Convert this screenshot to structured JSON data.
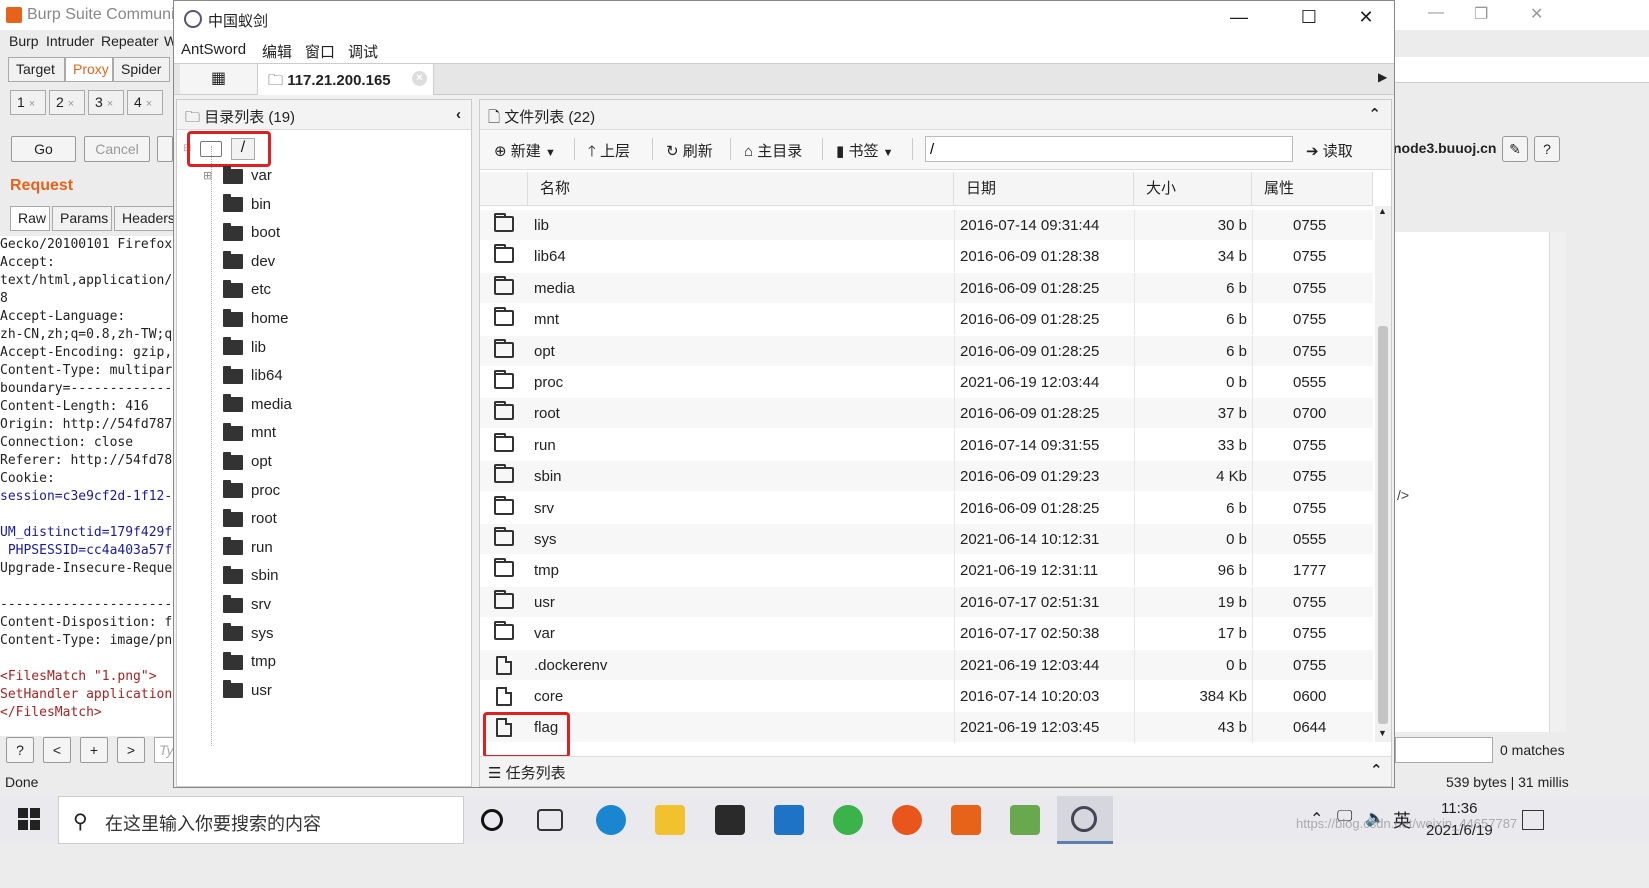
{
  "burp": {
    "title": "Burp Suite Communit",
    "menu": [
      "Burp",
      "Intruder",
      "Repeater",
      "W"
    ],
    "main_tabs": [
      "Target",
      "Proxy",
      "Spider"
    ],
    "sub_tabs": [
      "1",
      "2",
      "3",
      "4"
    ],
    "go_label": "Go",
    "cancel_label": "Cancel",
    "request_label": "Request",
    "req_tabs": [
      "Raw",
      "Params",
      "Headers"
    ],
    "request_lines": [
      {
        "t": "Gecko/20100101 Firefox/",
        "c": ""
      },
      {
        "t": "Accept:",
        "c": ""
      },
      {
        "t": "text/html,application/:",
        "c": ""
      },
      {
        "t": "8",
        "c": ""
      },
      {
        "t": "Accept-Language:",
        "c": ""
      },
      {
        "t": "zh-CN,zh;q=0.8,zh-TW;q",
        "c": ""
      },
      {
        "t": "Accept-Encoding: gzip,",
        "c": ""
      },
      {
        "t": "Content-Type: multipar",
        "c": ""
      },
      {
        "t": "boundary=--------------",
        "c": ""
      },
      {
        "t": "Content-Length: 416",
        "c": ""
      },
      {
        "t": "Origin: http://54fd787",
        "c": ""
      },
      {
        "t": "Connection: close",
        "c": ""
      },
      {
        "t": "Referer: http://54fd78",
        "c": ""
      },
      {
        "t": "Cookie:",
        "c": ""
      },
      {
        "t": "session=c3e9cf2d-1f12-",
        "c": "blue"
      },
      {
        "t": "",
        "c": ""
      },
      {
        "t": "UM_distinctid=179f429f",
        "c": "blue"
      },
      {
        "t": " PHPSESSID=cc4a403a57f",
        "c": "blue"
      },
      {
        "t": "Upgrade-Insecure-Reques",
        "c": ""
      },
      {
        "t": "",
        "c": ""
      },
      {
        "t": "-----------------------",
        "c": ""
      },
      {
        "t": "Content-Disposition: f",
        "c": ""
      },
      {
        "t": "Content-Type: image/pn",
        "c": ""
      },
      {
        "t": "",
        "c": ""
      },
      {
        "t": "<FilesMatch \"1.png\">",
        "c": "red"
      },
      {
        "t": "SetHandler application",
        "c": "red"
      },
      {
        "t": "</FilesMatch>",
        "c": "red"
      }
    ],
    "host": "node3.buuoj.cn",
    "right_tag": "/>",
    "matches": "0 matches",
    "status_left": "Done",
    "status_right": "539 bytes | 31 millis",
    "search_placeholder": "Ty"
  },
  "antsword": {
    "title": "中国蚁剑",
    "menu": [
      "AntSword",
      "编辑",
      "窗口",
      "调试"
    ],
    "tab_label": "117.21.200.165",
    "dir_panel_title": "目录列表 (19)",
    "tree_root": "/",
    "tree": [
      "var",
      "bin",
      "boot",
      "dev",
      "etc",
      "home",
      "lib",
      "lib64",
      "media",
      "mnt",
      "opt",
      "proc",
      "root",
      "run",
      "sbin",
      "srv",
      "sys",
      "tmp",
      "usr"
    ],
    "file_panel_title": "文件列表 (22)",
    "toolbar": {
      "new": "新建",
      "up": "上层",
      "refresh": "刷新",
      "home": "主目录",
      "bookmark": "书签",
      "path": "/",
      "read": "读取"
    },
    "columns": [
      "名称",
      "日期",
      "大小",
      "属性"
    ],
    "files": [
      {
        "type": "folder",
        "name": "lib",
        "date": "2016-07-14 09:31:44",
        "size": "30 b",
        "perm": "0755"
      },
      {
        "type": "folder",
        "name": "lib64",
        "date": "2016-06-09 01:28:38",
        "size": "34 b",
        "perm": "0755"
      },
      {
        "type": "folder",
        "name": "media",
        "date": "2016-06-09 01:28:25",
        "size": "6 b",
        "perm": "0755"
      },
      {
        "type": "folder",
        "name": "mnt",
        "date": "2016-06-09 01:28:25",
        "size": "6 b",
        "perm": "0755"
      },
      {
        "type": "folder",
        "name": "opt",
        "date": "2016-06-09 01:28:25",
        "size": "6 b",
        "perm": "0755"
      },
      {
        "type": "folder",
        "name": "proc",
        "date": "2021-06-19 12:03:44",
        "size": "0 b",
        "perm": "0555"
      },
      {
        "type": "folder",
        "name": "root",
        "date": "2016-06-09 01:28:25",
        "size": "37 b",
        "perm": "0700"
      },
      {
        "type": "folder",
        "name": "run",
        "date": "2016-07-14 09:31:55",
        "size": "33 b",
        "perm": "0755"
      },
      {
        "type": "folder",
        "name": "sbin",
        "date": "2016-06-09 01:29:23",
        "size": "4 Kb",
        "perm": "0755"
      },
      {
        "type": "folder",
        "name": "srv",
        "date": "2016-06-09 01:28:25",
        "size": "6 b",
        "perm": "0755"
      },
      {
        "type": "folder",
        "name": "sys",
        "date": "2021-06-14 10:12:31",
        "size": "0 b",
        "perm": "0555"
      },
      {
        "type": "folder",
        "name": "tmp",
        "date": "2021-06-19 12:31:11",
        "size": "96 b",
        "perm": "1777"
      },
      {
        "type": "folder",
        "name": "usr",
        "date": "2016-07-17 02:51:31",
        "size": "19 b",
        "perm": "0755"
      },
      {
        "type": "folder",
        "name": "var",
        "date": "2016-07-17 02:50:38",
        "size": "17 b",
        "perm": "0755"
      },
      {
        "type": "file",
        "name": ".dockerenv",
        "date": "2021-06-19 12:03:44",
        "size": "0 b",
        "perm": "0755"
      },
      {
        "type": "file",
        "name": "core",
        "date": "2016-07-14 10:20:03",
        "size": "384 Kb",
        "perm": "0600"
      },
      {
        "type": "file",
        "name": "flag",
        "date": "2021-06-19 12:03:45",
        "size": "43 b",
        "perm": "0644"
      }
    ],
    "task_list": "任务列表"
  },
  "taskbar": {
    "search_placeholder": "在这里输入你要搜索的内容",
    "ime": "英",
    "time": "11:36",
    "date": "2021/6/19",
    "watermark": "https://blog.csdn.net/weixin_44657787"
  },
  "colors": {
    "highlight_red": "#e02020",
    "burp_orange": "#e8631a",
    "proxy_tab_text": "#e8631a"
  }
}
